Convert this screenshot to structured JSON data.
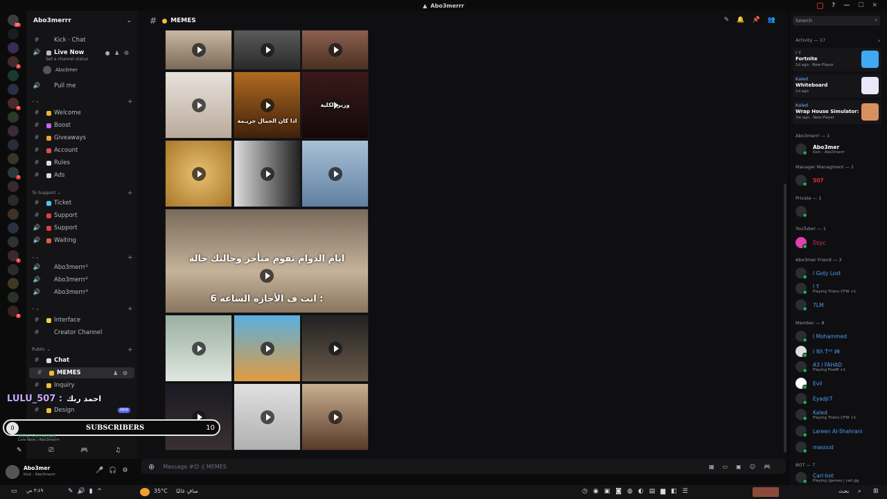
{
  "window": {
    "title": "Abo3merrr"
  },
  "server": {
    "name": "Abo3merrr"
  },
  "channels": {
    "kick_chat": "Kick · Chat",
    "live_now": "Live Now",
    "live_status": "Set a channel status",
    "voice_user": "Abo3mer",
    "pull_me": "Pull me",
    "welcome": "Welcome",
    "boost": "Boost",
    "giveaways": "Giveaways",
    "account": "Account",
    "rules": "Rules",
    "ads": "Ads",
    "to_support": "To Support",
    "ticket": "Ticket",
    "support1": "Support",
    "support2": "Support",
    "waiting": "Waiting",
    "v1": "Abo3merrr¹",
    "v2": "Abo3merrr²",
    "v3": "Abo3merrr³",
    "interface": "Interface",
    "creator": "Creator Channel",
    "public": "Public",
    "chat": "Chat",
    "memes": "MEMES",
    "inquiry": "Inquiry",
    "design": "Design",
    "new_badge": "NEW"
  },
  "overlay": {
    "lulu": "LULU_507 :",
    "lulu_msg": "احمد ربك",
    "subs_label": "SUBSCRIBERS",
    "subs_start": "0",
    "subs_goal": "10"
  },
  "voice": {
    "status": "Voice Connected",
    "sub": "Live Now / Abo3merrr"
  },
  "user": {
    "name": "Abo3mer",
    "status": "Kick : Abo3merrr"
  },
  "main": {
    "channel": "MEMES",
    "placeholder": "Message #😊 ı| MEMES"
  },
  "captions": {
    "c1": "اذا كان الجمال جريـمة",
    "c2": "وزير الكلية",
    "c3": "ايام الدوام تقوم متأخر وحالتك حالة",
    "c4": "انت ف الأجازه الساعه 6 :"
  },
  "right": {
    "search": "Search",
    "activity": "Activity — 17",
    "act1": {
      "who": "I Y",
      "game": "Fortnite",
      "sub": "1d ago · New Player"
    },
    "act2": {
      "who": "Kaled",
      "game": "Whiteboard",
      "sub": "1d ago"
    },
    "act3": {
      "who": "Kaled",
      "game": "Wrap House Simulator: Pro...",
      "sub": "3w ago · New Player"
    },
    "grp1": "Abo3merrr — 1",
    "m1": {
      "name": "Abo3mer",
      "st": "Kick : Abo3merrr"
    },
    "grp2": "Manager Managment — 1",
    "m2": {
      "name": "507"
    },
    "grp3": "Private — 1",
    "grp4": "YouTuber — 1",
    "m4": {
      "name": "Dzyc"
    },
    "grp5": "Abo3mer Friend — 3",
    "m5a": {
      "name": "I Goty Lost"
    },
    "m5b": {
      "name": "I Y",
      "st": "Playing Titans CFW +1"
    },
    "m5c": {
      "name": "7LM"
    },
    "grp6": "Member — 8",
    "m6a": {
      "name": "I Mohammed"
    },
    "m6b": {
      "name": "I ЯΛ Ƭᴴᴱ ИƗ"
    },
    "m6c": {
      "name": "A3 l FAHAD",
      "st": "Playing FiveM +1"
    },
    "m6d": {
      "name": "Evil"
    },
    "m6e": {
      "name": "Eyadjr7"
    },
    "m6f": {
      "name": "Kaled",
      "st": "Playing Titans CFW +1"
    },
    "m6g": {
      "name": "Lareen Al-Shahrani"
    },
    "m6h": {
      "name": "masoud"
    },
    "grp7": "BOT — 7",
    "m7": {
      "name": "Carl-bot",
      "st": "Playing /games | carl.gg"
    }
  },
  "taskbar": {
    "weather": "35°C",
    "weather_text": "صافٍ غالبًا",
    "search": "بحث",
    "clock": "٣:٤٩ ص"
  },
  "colors": {
    "accent": "#5865f2",
    "online": "#23a55a",
    "background": "#0f0f11"
  }
}
